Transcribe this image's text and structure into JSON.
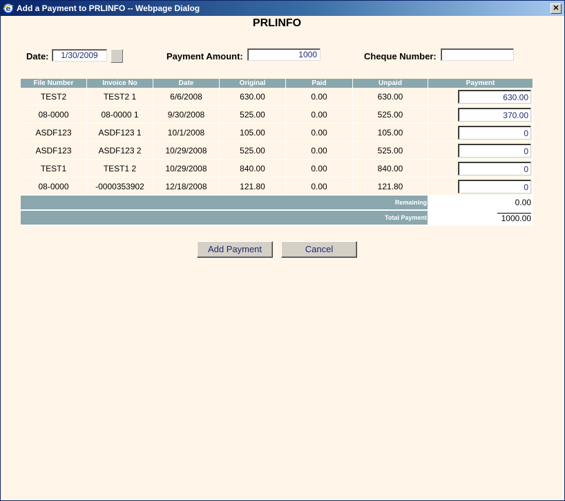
{
  "window": {
    "title": "Add a Payment to PRLINFO -- Webpage Dialog",
    "close_glyph": "✕"
  },
  "heading": "PRLINFO",
  "form": {
    "date_label": "Date:",
    "date_value": "1/30/2009",
    "amount_label": "Payment Amount:",
    "amount_value": "1000",
    "cheque_label": "Cheque Number:",
    "cheque_value": ""
  },
  "table": {
    "headers": [
      "File Number",
      "Invoice No",
      "Date",
      "Original",
      "Paid",
      "Unpaid",
      "Payment"
    ],
    "rows": [
      {
        "file": "TEST2",
        "invoice": "TEST2 1",
        "date": "6/6/2008",
        "original": "630.00",
        "paid": "0.00",
        "unpaid": "630.00",
        "payment": "630.00"
      },
      {
        "file": "08-0000",
        "invoice": "08-0000 1",
        "date": "9/30/2008",
        "original": "525.00",
        "paid": "0.00",
        "unpaid": "525.00",
        "payment": "370.00"
      },
      {
        "file": "ASDF123",
        "invoice": "ASDF123 1",
        "date": "10/1/2008",
        "original": "105.00",
        "paid": "0.00",
        "unpaid": "105.00",
        "payment": "0"
      },
      {
        "file": "ASDF123",
        "invoice": "ASDF123 2",
        "date": "10/29/2008",
        "original": "525.00",
        "paid": "0.00",
        "unpaid": "525.00",
        "payment": "0"
      },
      {
        "file": "TEST1",
        "invoice": "TEST1 2",
        "date": "10/29/2008",
        "original": "840.00",
        "paid": "0.00",
        "unpaid": "840.00",
        "payment": "0"
      },
      {
        "file": "08-0000",
        "invoice": "-0000353902",
        "date": "12/18/2008",
        "original": "121.80",
        "paid": "0.00",
        "unpaid": "121.80",
        "payment": "0"
      }
    ],
    "remaining_label": "Remaining",
    "remaining_value": "0.00",
    "total_label": "Total Payment",
    "total_value": "1000.00"
  },
  "buttons": {
    "add_payment": "Add Payment",
    "cancel": "Cancel"
  },
  "colors": {
    "header_bg": "#8aa7ad",
    "page_bg": "#fff5e8",
    "titlebar": "#0a246a"
  }
}
